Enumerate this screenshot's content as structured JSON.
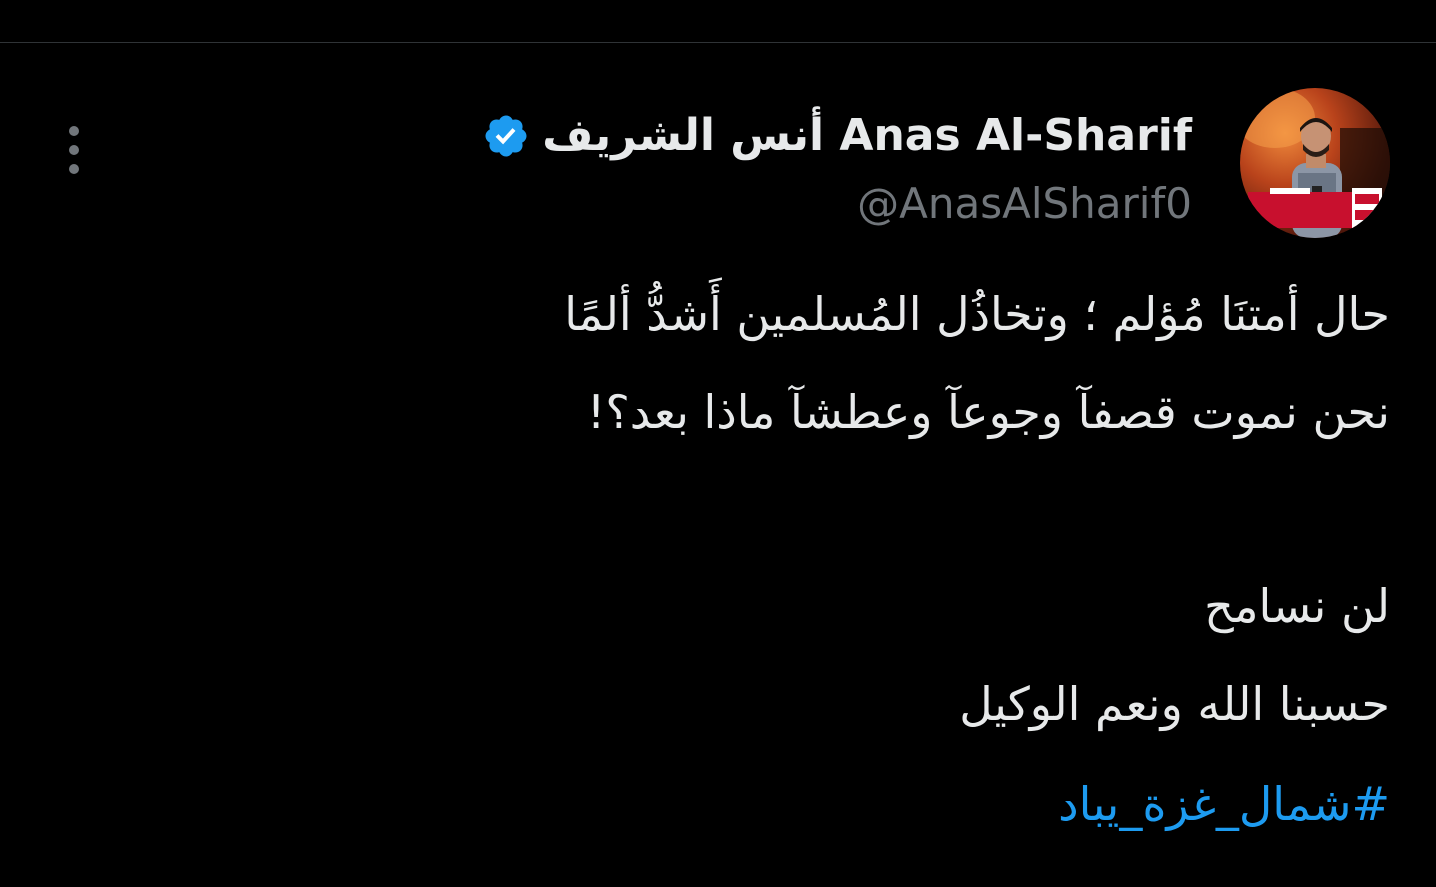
{
  "tweet": {
    "author": {
      "display_name": "أنس الشريف Anas Al-Sharif",
      "handle": "@AnasAlSharif0",
      "verified": true,
      "verified_color": "#1d9bf0"
    },
    "lines": [
      "حال أمتنَا مُؤلم ؛ وتخاذُل المُسلمين أَشدُّ ألمًا",
      "نحن نموت قصفآ وجوعآ وعطشآ ماذا بعد؟!",
      "لن نسامح",
      "حسبنا الله ونعم الوكيل"
    ],
    "hashtag": "#شمال_غزة_يباد"
  },
  "colors": {
    "background": "#000000",
    "text": "#e7e9ea",
    "secondary_text": "#71767b",
    "accent": "#1d9bf0"
  }
}
